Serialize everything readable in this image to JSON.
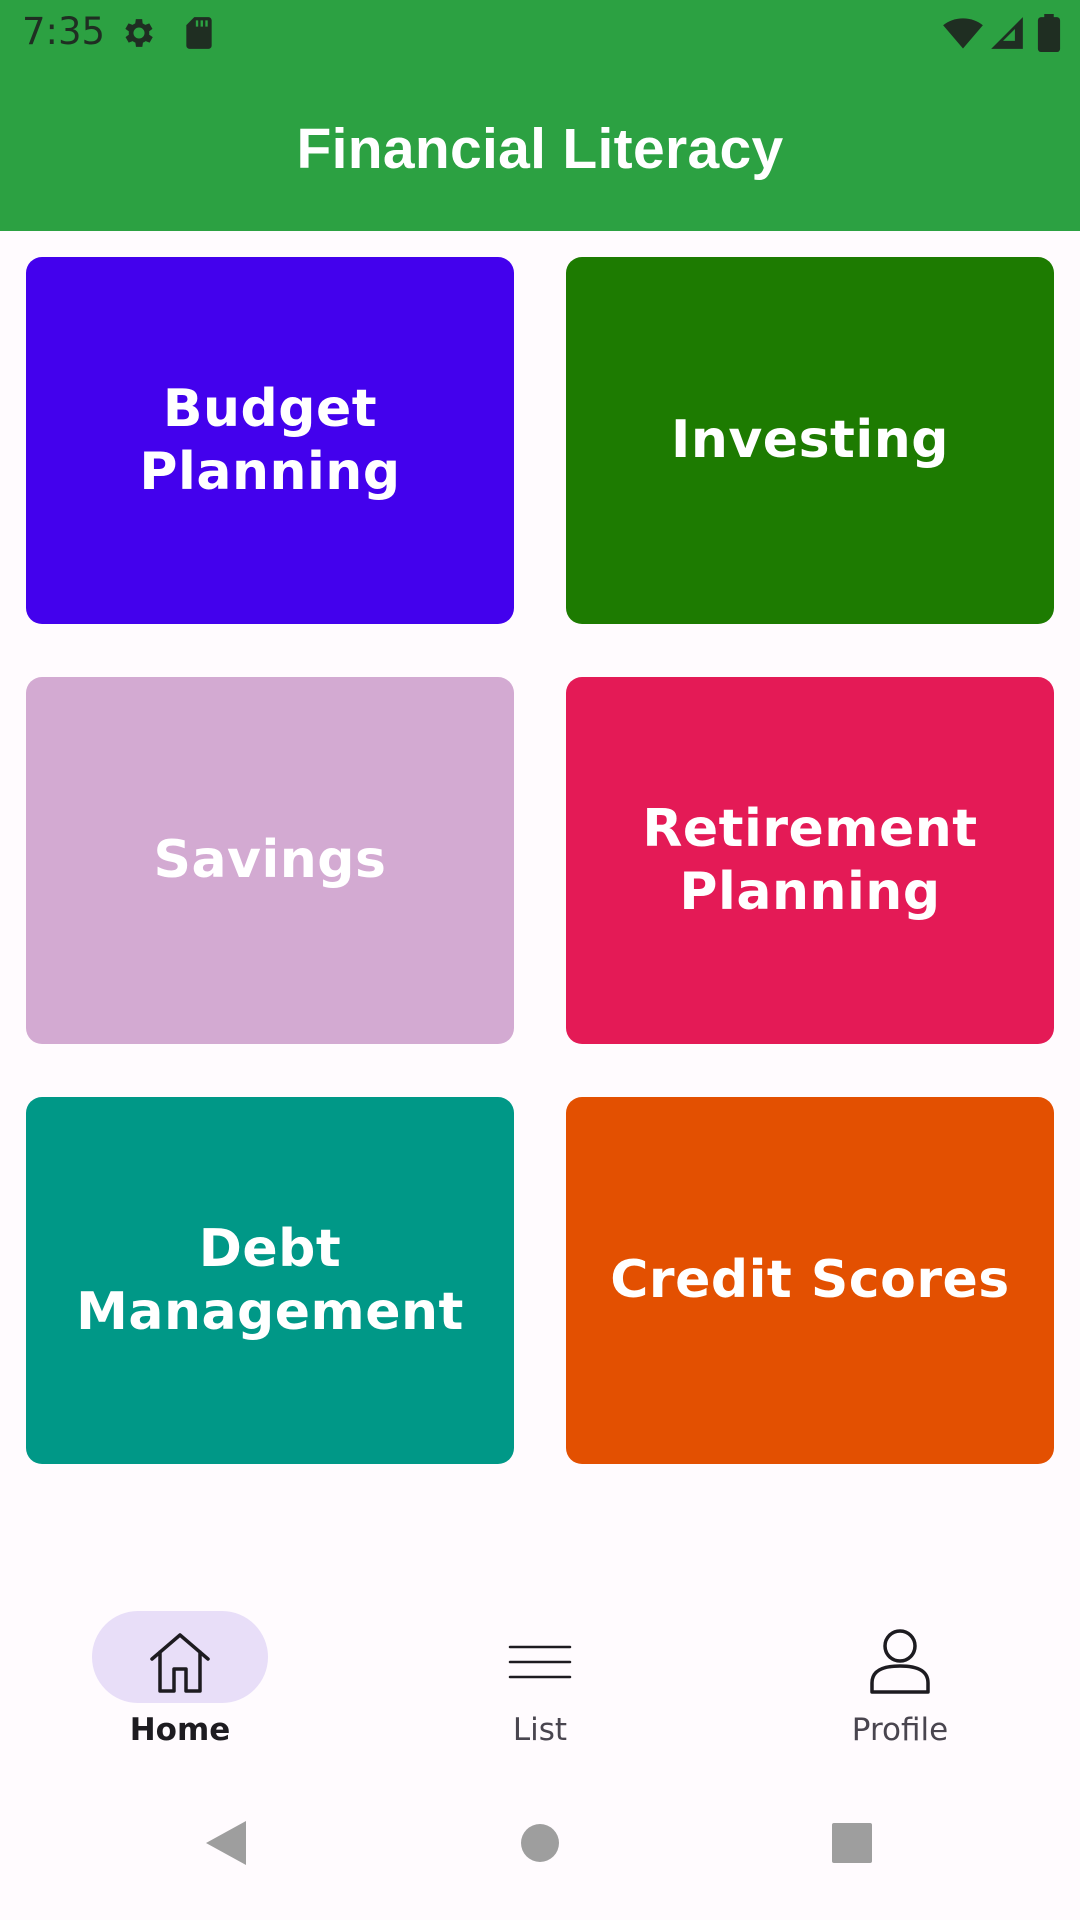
{
  "status_bar": {
    "time": "7:35",
    "icons": [
      "gear-icon",
      "sd-card-icon",
      "wifi-icon",
      "signal-icon",
      "battery-icon"
    ]
  },
  "app_bar": {
    "title": "Financial Literacy",
    "color": "#2CA142"
  },
  "categories": [
    {
      "label": "Budget Planning",
      "color": "#4301ED"
    },
    {
      "label": "Investing",
      "color": "#1D7B01"
    },
    {
      "label": "Savings",
      "color": "#D3AAD2"
    },
    {
      "label": "Retirement Planning",
      "color": "#E41A56"
    },
    {
      "label": "Debt Management",
      "color": "#009887"
    },
    {
      "label": "Credit Scores",
      "color": "#E35001"
    }
  ],
  "bottom_nav": {
    "items": [
      {
        "label": "Home",
        "icon": "home-icon",
        "active": true
      },
      {
        "label": "List",
        "icon": "list-icon",
        "active": false
      },
      {
        "label": "Profile",
        "icon": "person-icon",
        "active": false
      }
    ]
  },
  "system_nav": {
    "icons": [
      "back-icon",
      "home-circle-icon",
      "recents-icon"
    ]
  }
}
